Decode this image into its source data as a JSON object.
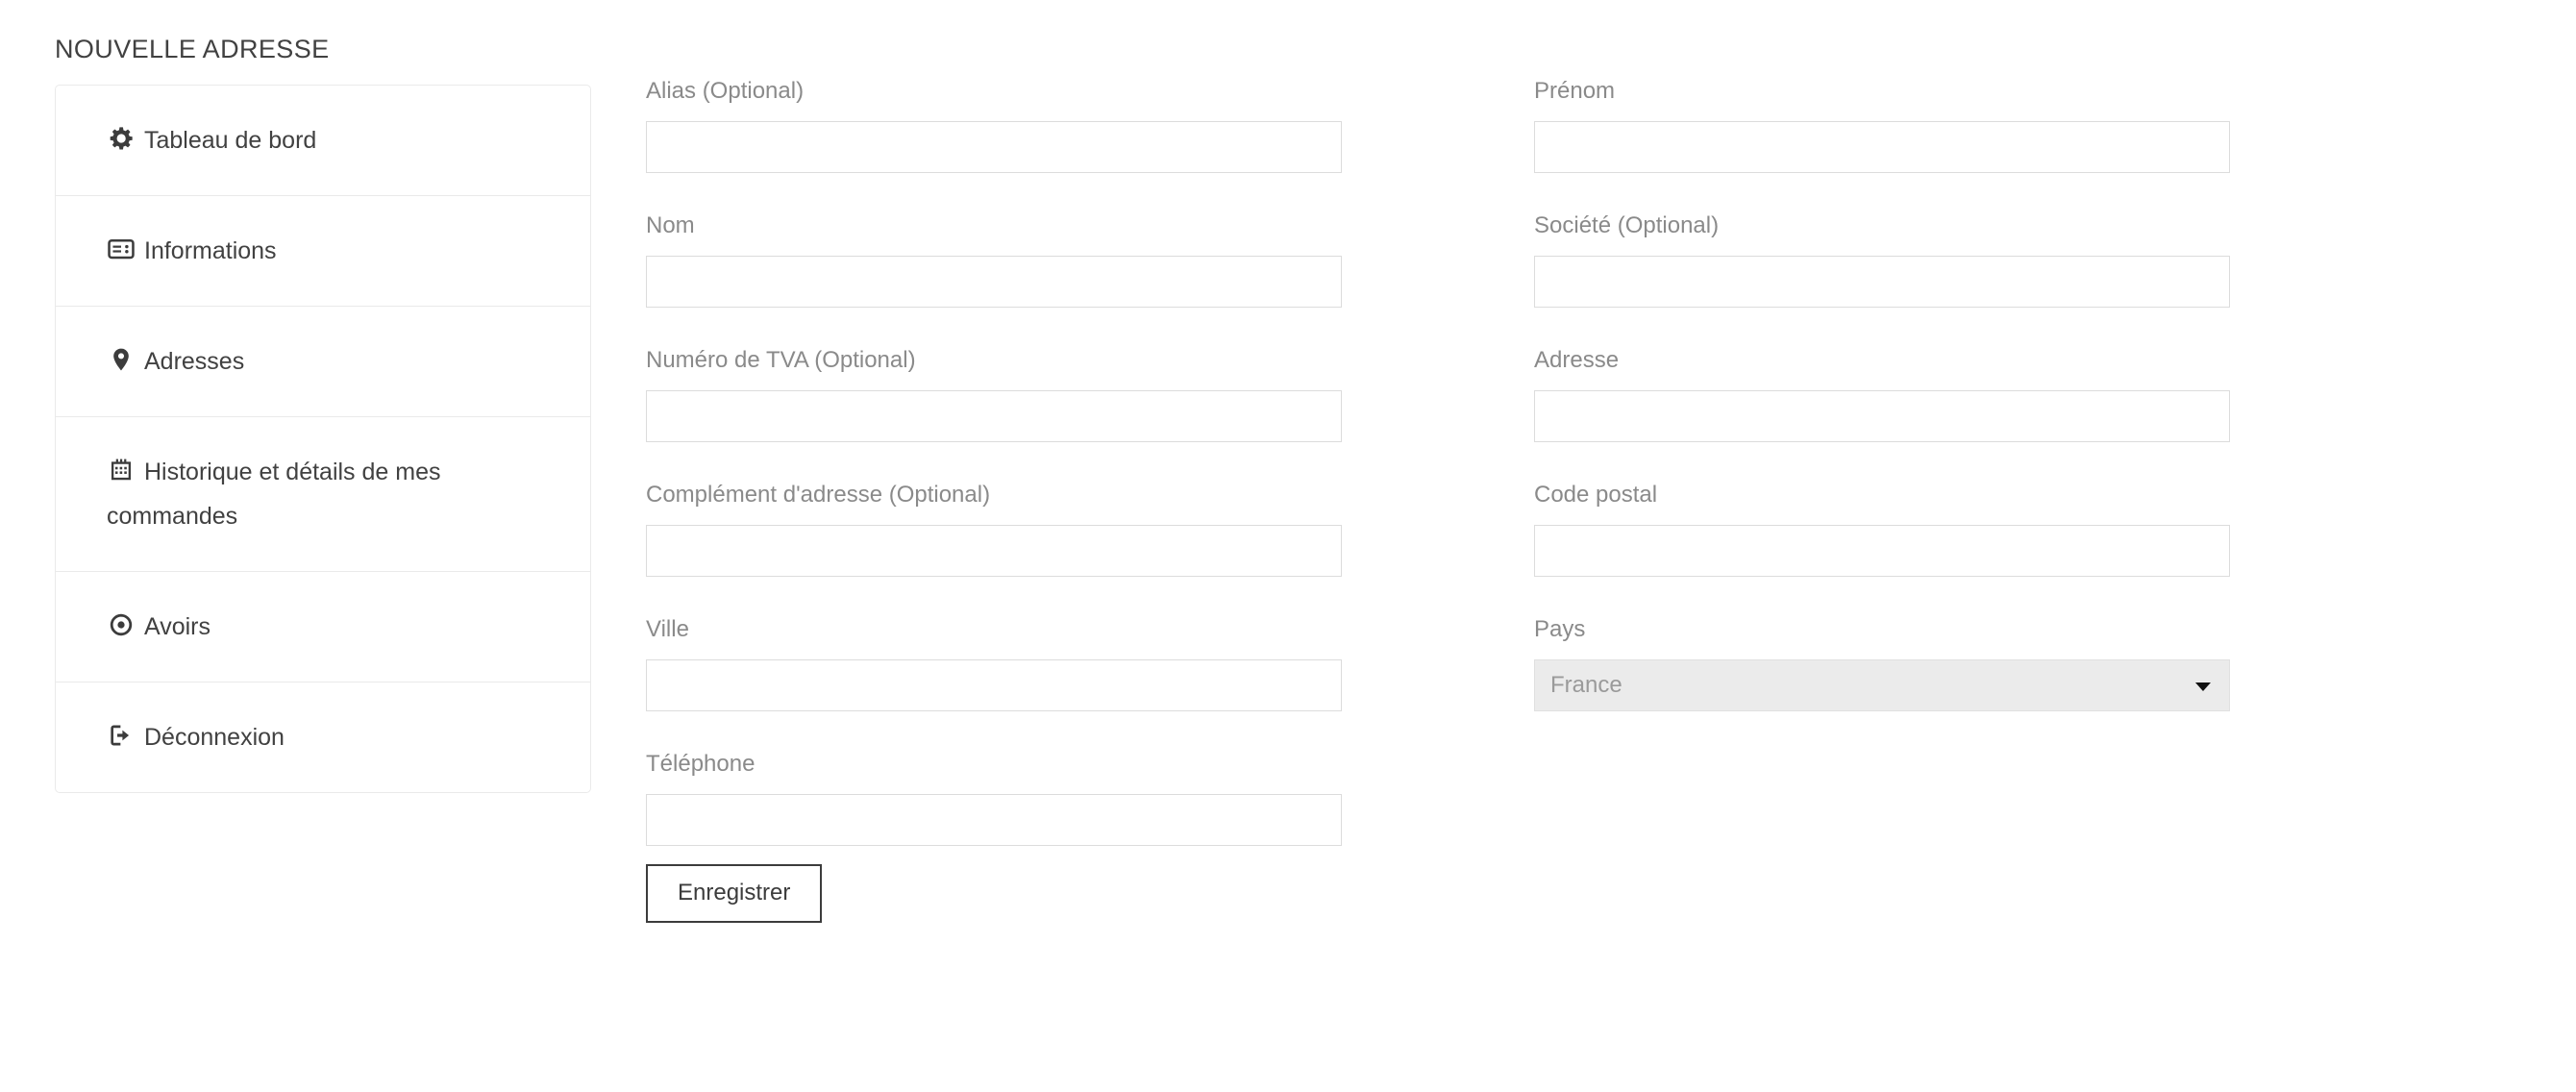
{
  "page": {
    "title": "NOUVELLE ADRESSE"
  },
  "sidebar": {
    "items": [
      {
        "label": "Tableau de bord",
        "icon": "gear-icon"
      },
      {
        "label": "Informations",
        "icon": "id-card-icon"
      },
      {
        "label": "Adresses",
        "icon": "map-pin-icon"
      },
      {
        "label": "Historique et détails de mes commandes",
        "icon": "calendar-history-icon"
      },
      {
        "label": "Avoirs",
        "icon": "circle-dot-icon"
      },
      {
        "label": "Déconnexion",
        "icon": "logout-icon"
      }
    ]
  },
  "form": {
    "left_column": [
      {
        "label": "Alias (Optional)",
        "value": "",
        "placeholder": "",
        "type": "text"
      },
      {
        "label": "Nom",
        "value": "",
        "placeholder": "",
        "type": "text"
      },
      {
        "label": "Numéro de TVA (Optional)",
        "value": "",
        "placeholder": "",
        "type": "text"
      },
      {
        "label": "Complément d'adresse (Optional)",
        "value": "",
        "placeholder": "",
        "type": "text"
      },
      {
        "label": "Ville",
        "value": "",
        "placeholder": "",
        "type": "text"
      },
      {
        "label": "Téléphone",
        "value": "",
        "placeholder": "",
        "type": "text"
      }
    ],
    "right_column": [
      {
        "label": "Prénom",
        "value": "",
        "placeholder": "",
        "type": "text"
      },
      {
        "label": "Société (Optional)",
        "value": "",
        "placeholder": "",
        "type": "text"
      },
      {
        "label": "Adresse",
        "value": "",
        "placeholder": "",
        "type": "text"
      },
      {
        "label": "Code postal",
        "value": "",
        "placeholder": "",
        "type": "text"
      },
      {
        "label": "Pays",
        "value": "France",
        "type": "select",
        "options": [
          "France"
        ]
      }
    ],
    "submit_label": "Enregistrer"
  },
  "colors": {
    "text": "#414141",
    "label": "#8a8a8a",
    "input_border": "#dcdcdc",
    "panel_border": "#eaeaea",
    "select_bg": "#ebebeb",
    "button_border": "#3c3c3c"
  }
}
